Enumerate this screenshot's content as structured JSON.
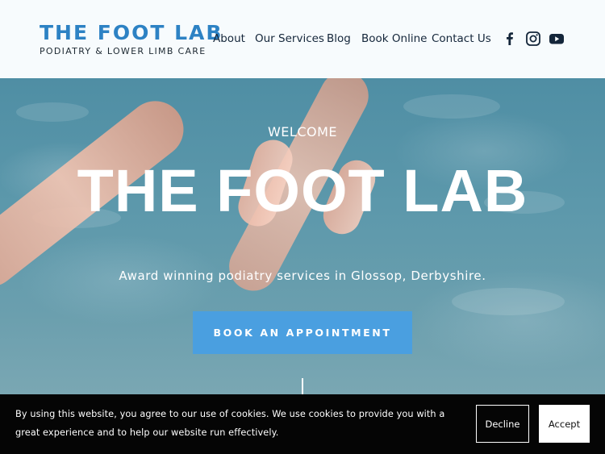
{
  "header": {
    "logo_title": "THE FOOT LAB",
    "logo_subtitle": "PODIATRY & LOWER LIMB CARE",
    "nav": {
      "about": "About",
      "services": "Our Services",
      "blog": "Blog",
      "book": "Book Online",
      "contact": "Contact Us"
    },
    "social_icons": [
      "facebook-icon",
      "instagram-icon",
      "youtube-icon"
    ]
  },
  "hero": {
    "welcome": "WELCOME",
    "title": "THE FOOT LAB",
    "tagline": "Award winning podiatry services in Glossop, Derbyshire.",
    "cta_label": "BOOK AN APPOINTMENT"
  },
  "cookie_banner": {
    "text": "By using this website, you agree to our use of cookies. We use cookies to provide you with a great experience and to help our website run effectively.",
    "decline_label": "Decline",
    "accept_label": "Accept"
  },
  "colors": {
    "brand_blue": "#2d82c4",
    "cta_blue": "#4a9fe0",
    "header_bg": "#f7fbfd",
    "banner_bg": "#050505"
  }
}
